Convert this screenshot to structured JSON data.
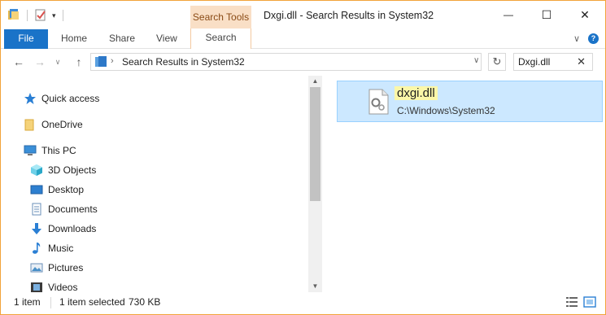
{
  "window": {
    "title": "Dxgi.dll - Search Results in System32",
    "context_tab": "Search Tools",
    "controls": {
      "minimize": "—",
      "maximize": "☐",
      "close": "✕"
    }
  },
  "ribbon": {
    "tabs": [
      "File",
      "Home",
      "Share",
      "View",
      "Search"
    ]
  },
  "address": {
    "chevron": "›",
    "path": "Search Results in System32",
    "dropdown": "∨",
    "refresh": "↻"
  },
  "nav_buttons": {
    "back": "←",
    "forward": "→",
    "recent": "∨",
    "up": "↑"
  },
  "search": {
    "value": "Dxgi.dll",
    "clear": "✕"
  },
  "navpane": {
    "items": [
      {
        "label": "Quick access",
        "icon": "star-icon"
      },
      {
        "label": "OneDrive",
        "icon": "folder-icon"
      },
      {
        "label": "This PC",
        "icon": "computer-icon"
      },
      {
        "label": "3D Objects",
        "icon": "cube-icon"
      },
      {
        "label": "Desktop",
        "icon": "desktop-icon"
      },
      {
        "label": "Documents",
        "icon": "document-icon"
      },
      {
        "label": "Downloads",
        "icon": "download-icon"
      },
      {
        "label": "Music",
        "icon": "music-icon"
      },
      {
        "label": "Pictures",
        "icon": "pictures-icon"
      },
      {
        "label": "Videos",
        "icon": "video-icon"
      }
    ]
  },
  "results": [
    {
      "name": "dxgi.dll",
      "path": "C:\\Windows\\System32",
      "icon": "dll-file-icon"
    }
  ],
  "status": {
    "count": "1 item",
    "selected": "1 item selected",
    "size": "730 KB"
  },
  "colors": {
    "file_tab": "#1a73c8",
    "context_tab": "#f9dfc6",
    "selection": "#cce8ff",
    "highlight": "#fbf7a8",
    "window_border": "#f2a33a"
  }
}
